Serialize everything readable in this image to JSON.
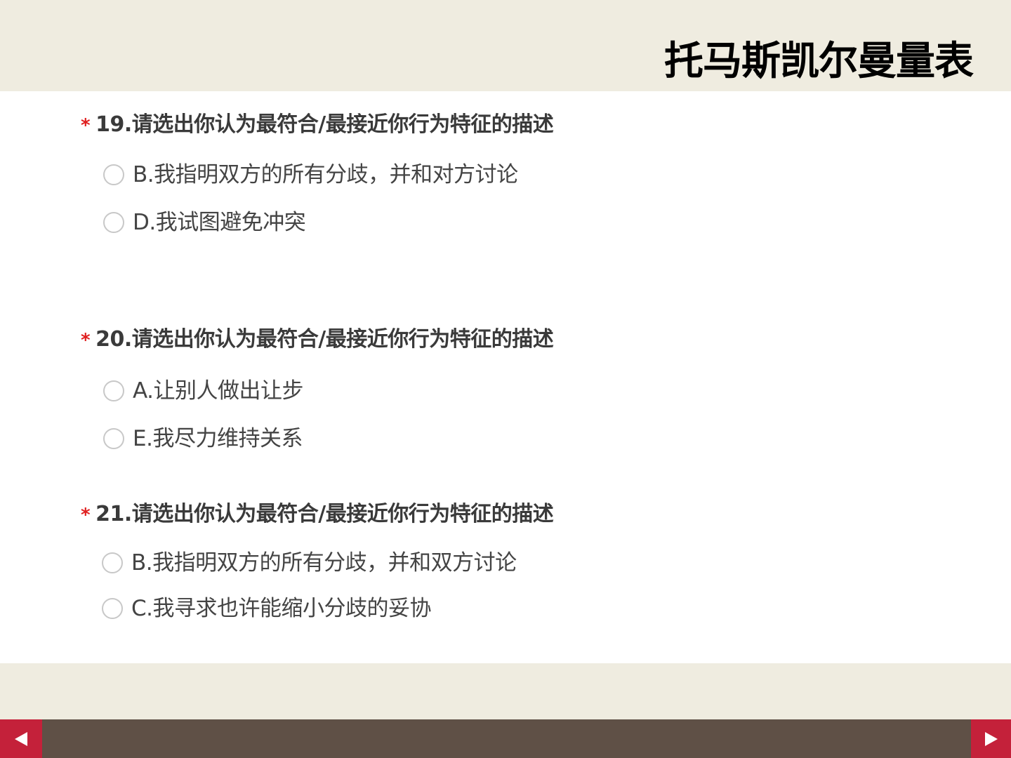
{
  "title": "托马斯凯尔曼量表",
  "questions": [
    {
      "required_mark": "*",
      "title": "19.请选出你认为最符合/最接近你行为特征的描述",
      "options": [
        {
          "label": "B.我指明双方的所有分歧，并和对方讨论"
        },
        {
          "label": "D.我试图避免冲突"
        }
      ]
    },
    {
      "required_mark": "*",
      "title": "20.请选出你认为最符合/最接近你行为特征的描述",
      "options": [
        {
          "label": "A.让别人做出让步"
        },
        {
          "label": "E.我尽力维持关系"
        }
      ]
    },
    {
      "required_mark": "*",
      "title": "21.请选出你认为最符合/最接近你行为特征的描述",
      "options": [
        {
          "label": "B.我指明双方的所有分歧，并和双方讨论"
        },
        {
          "label": "C.我寻求也许能缩小分歧的妥协"
        }
      ]
    }
  ],
  "colors": {
    "background": "#efece0",
    "content": "#ffffff",
    "required": "#e02020",
    "nav_button": "#c4213a",
    "bottom_bar": "#5f5046"
  },
  "nav": {
    "prev_icon": "triangle-left-icon",
    "next_icon": "triangle-right-icon"
  }
}
